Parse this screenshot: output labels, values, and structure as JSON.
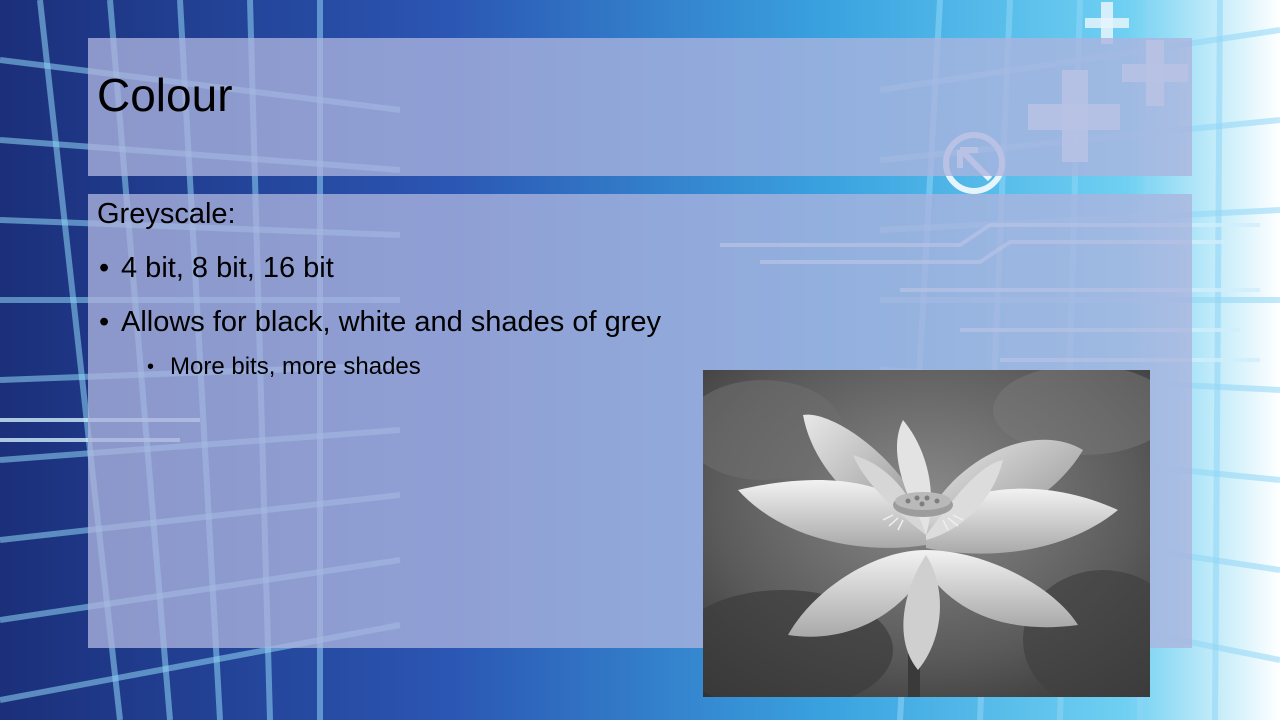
{
  "slide": {
    "title": "Colour",
    "heading": "Greyscale:",
    "bullets": [
      "4 bit, 8 bit, 16 bit",
      "Allows for black, white and shades of grey"
    ],
    "sub_bullets": [
      "More bits, more shades"
    ],
    "bullet_glyph": "•"
  },
  "image": {
    "description_icon": "lotus-flower-photo",
    "tone": "greyscale"
  },
  "theme": {
    "background_dark": "#1b2f7a",
    "background_light": "#3fb2e6",
    "panel_tint": "#acb4de"
  }
}
